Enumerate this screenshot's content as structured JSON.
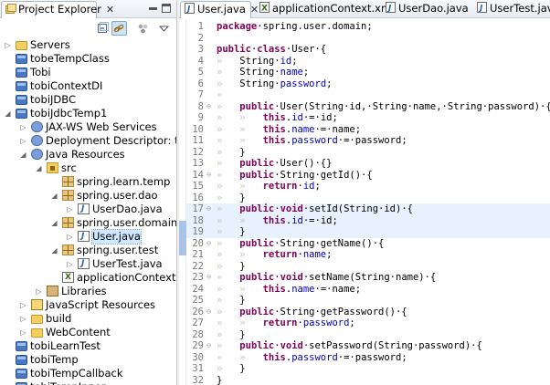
{
  "explorer": {
    "tab_title": "Project Explorer",
    "tree": [
      {
        "label": "Servers",
        "indent": 0,
        "icon": "folder",
        "twisty": "▷"
      },
      {
        "label": "tobeTempClass",
        "indent": 0,
        "icon": "project",
        "twisty": ""
      },
      {
        "label": "Tobi",
        "indent": 0,
        "icon": "project",
        "twisty": ""
      },
      {
        "label": "tobiContextDI",
        "indent": 0,
        "icon": "project",
        "twisty": ""
      },
      {
        "label": "tobiJDBC",
        "indent": 0,
        "icon": "project",
        "twisty": ""
      },
      {
        "label": "tobiJdbcTemp1",
        "indent": 0,
        "icon": "project",
        "twisty": "◢"
      },
      {
        "label": "JAX-WS Web Services",
        "indent": 1,
        "icon": "jaxws",
        "twisty": "▷"
      },
      {
        "label": "Deployment Descriptor: tobiJdb",
        "indent": 1,
        "icon": "dd",
        "twisty": "▷"
      },
      {
        "label": "Java Resources",
        "indent": 1,
        "icon": "jres",
        "twisty": "◢"
      },
      {
        "label": "src",
        "indent": 2,
        "icon": "src",
        "twisty": "◢"
      },
      {
        "label": "spring.learn.temp",
        "indent": 3,
        "icon": "pkg",
        "twisty": ""
      },
      {
        "label": "spring.user.dao",
        "indent": 3,
        "icon": "pkg",
        "twisty": "◢"
      },
      {
        "label": "UserDao.java",
        "indent": 4,
        "icon": "java",
        "twisty": "▷"
      },
      {
        "label": "spring.user.domain",
        "indent": 3,
        "icon": "pkg",
        "twisty": "◢"
      },
      {
        "label": "User.java",
        "indent": 4,
        "icon": "java",
        "twisty": "▷",
        "selected": true
      },
      {
        "label": "spring.user.test",
        "indent": 3,
        "icon": "pkg",
        "twisty": "◢"
      },
      {
        "label": "UserTest.java",
        "indent": 4,
        "icon": "java",
        "twisty": "▷"
      },
      {
        "label": "applicationContext.xml",
        "indent": 3,
        "icon": "xml",
        "twisty": ""
      },
      {
        "label": "Libraries",
        "indent": 2,
        "icon": "lib",
        "twisty": "▷"
      },
      {
        "label": "JavaScript Resources",
        "indent": 1,
        "icon": "js",
        "twisty": "▷"
      },
      {
        "label": "build",
        "indent": 1,
        "icon": "folder",
        "twisty": "▷"
      },
      {
        "label": "WebContent",
        "indent": 1,
        "icon": "folder",
        "twisty": "▷"
      },
      {
        "label": "tobiLearnTest",
        "indent": 0,
        "icon": "project",
        "twisty": ""
      },
      {
        "label": "tobiTemp",
        "indent": 0,
        "icon": "project",
        "twisty": ""
      },
      {
        "label": "tobiTempCallback",
        "indent": 0,
        "icon": "project",
        "twisty": ""
      },
      {
        "label": "tobiTempInner",
        "indent": 0,
        "icon": "project",
        "twisty": ""
      }
    ]
  },
  "editor": {
    "tabs": [
      {
        "label": "User.java",
        "icon": "java-file-icon",
        "active": true
      },
      {
        "label": "applicationContext.xml",
        "icon": "xml-file-icon",
        "active": false
      },
      {
        "label": "UserDao.java",
        "icon": "java-file-icon",
        "active": false
      },
      {
        "label": "UserTest.java",
        "icon": "java-file-icon",
        "active": false
      }
    ],
    "lines": [
      {
        "n": "1",
        "fold": "",
        "hl": false,
        "segs": [
          [
            "kw",
            "package"
          ],
          [
            "",
            "·spring.user.domain;"
          ]
        ]
      },
      {
        "n": "2",
        "fold": "",
        "hl": false,
        "segs": []
      },
      {
        "n": "3",
        "fold": "",
        "hl": false,
        "segs": [
          [
            "kw",
            "public"
          ],
          [
            "",
            "·"
          ],
          [
            "kw",
            "class"
          ],
          [
            "",
            "·User·{"
          ]
        ]
      },
      {
        "n": "4",
        "fold": "",
        "hl": false,
        "segs": [
          [
            "dot",
            "»   "
          ],
          [
            "",
            "String·"
          ],
          [
            "fld",
            "id"
          ],
          [
            "",
            ";"
          ]
        ]
      },
      {
        "n": "5",
        "fold": "",
        "hl": false,
        "segs": [
          [
            "dot",
            "»   "
          ],
          [
            "",
            "String·"
          ],
          [
            "fld",
            "name"
          ],
          [
            "",
            ";"
          ]
        ]
      },
      {
        "n": "6",
        "fold": "",
        "hl": false,
        "segs": [
          [
            "dot",
            "»   "
          ],
          [
            "",
            "String·"
          ],
          [
            "fld",
            "password"
          ],
          [
            "",
            ";"
          ]
        ]
      },
      {
        "n": "7",
        "fold": "",
        "hl": false,
        "segs": [
          [
            "dot",
            "»"
          ]
        ]
      },
      {
        "n": "8",
        "fold": "⊖",
        "hl": false,
        "segs": [
          [
            "dot",
            "»   "
          ],
          [
            "kw",
            "public"
          ],
          [
            "",
            "·User(String·id,·String·name,·String·password)·{"
          ]
        ]
      },
      {
        "n": "9",
        "fold": "",
        "hl": false,
        "segs": [
          [
            "dot",
            "»   »   "
          ],
          [
            "kw",
            "this"
          ],
          [
            "",
            "."
          ],
          [
            "fld",
            "id"
          ],
          [
            "",
            "·=·id;"
          ]
        ]
      },
      {
        "n": "10",
        "fold": "",
        "hl": false,
        "segs": [
          [
            "dot",
            "»   »   "
          ],
          [
            "kw",
            "this"
          ],
          [
            "",
            "."
          ],
          [
            "fld",
            "name"
          ],
          [
            "",
            "·=·name;"
          ]
        ]
      },
      {
        "n": "11",
        "fold": "",
        "hl": false,
        "segs": [
          [
            "dot",
            "»   »   "
          ],
          [
            "kw",
            "this"
          ],
          [
            "",
            "."
          ],
          [
            "fld",
            "password"
          ],
          [
            "",
            "·=·password;"
          ]
        ]
      },
      {
        "n": "12",
        "fold": "",
        "hl": false,
        "segs": [
          [
            "dot",
            "»   "
          ],
          [
            "",
            "}"
          ]
        ]
      },
      {
        "n": "13",
        "fold": "",
        "hl": false,
        "segs": [
          [
            "dot",
            "»   "
          ],
          [
            "kw",
            "public"
          ],
          [
            "",
            "·User()·{}"
          ]
        ]
      },
      {
        "n": "14",
        "fold": "⊖",
        "hl": false,
        "segs": [
          [
            "dot",
            "»   "
          ],
          [
            "kw",
            "public"
          ],
          [
            "",
            "·String·getId()·{"
          ]
        ]
      },
      {
        "n": "15",
        "fold": "",
        "hl": false,
        "segs": [
          [
            "dot",
            "»   »   "
          ],
          [
            "kw",
            "return"
          ],
          [
            "",
            "·"
          ],
          [
            "fld",
            "id"
          ],
          [
            "",
            ";"
          ]
        ]
      },
      {
        "n": "16",
        "fold": "",
        "hl": false,
        "segs": [
          [
            "dot",
            "»   "
          ],
          [
            "",
            "}"
          ]
        ]
      },
      {
        "n": "17",
        "fold": "⊖",
        "hl": true,
        "segs": [
          [
            "dot",
            "»   "
          ],
          [
            "kw",
            "public"
          ],
          [
            "",
            "·"
          ],
          [
            "kw",
            "void"
          ],
          [
            "",
            "·setId(String·id)·{"
          ]
        ]
      },
      {
        "n": "18",
        "fold": "",
        "hl": true,
        "segs": [
          [
            "dot",
            "»   »   "
          ],
          [
            "kw",
            "this"
          ],
          [
            "",
            "."
          ],
          [
            "fld",
            "id"
          ],
          [
            "",
            "·=·id;"
          ]
        ]
      },
      {
        "n": "19",
        "fold": "",
        "hl": true,
        "segs": [
          [
            "dot",
            "»   "
          ],
          [
            "",
            "}"
          ]
        ]
      },
      {
        "n": "20",
        "fold": "⊖",
        "hl": false,
        "segs": [
          [
            "dot",
            "»   "
          ],
          [
            "kw",
            "public"
          ],
          [
            "",
            "·String·getName()·{"
          ]
        ]
      },
      {
        "n": "21",
        "fold": "",
        "hl": false,
        "segs": [
          [
            "dot",
            "»   »   "
          ],
          [
            "kw",
            "return"
          ],
          [
            "",
            "·"
          ],
          [
            "fld",
            "name"
          ],
          [
            "",
            ";"
          ]
        ]
      },
      {
        "n": "22",
        "fold": "",
        "hl": false,
        "segs": [
          [
            "dot",
            "»   "
          ],
          [
            "",
            "}"
          ]
        ]
      },
      {
        "n": "23",
        "fold": "⊖",
        "hl": false,
        "segs": [
          [
            "dot",
            "»   "
          ],
          [
            "kw",
            "public"
          ],
          [
            "",
            "·"
          ],
          [
            "kw",
            "void"
          ],
          [
            "",
            "·setName(String·name)·{"
          ]
        ]
      },
      {
        "n": "24",
        "fold": "",
        "hl": false,
        "segs": [
          [
            "dot",
            "»   »   "
          ],
          [
            "kw",
            "this"
          ],
          [
            "",
            "."
          ],
          [
            "fld",
            "name"
          ],
          [
            "",
            "·=·name;"
          ]
        ]
      },
      {
        "n": "25",
        "fold": "",
        "hl": false,
        "segs": [
          [
            "dot",
            "»   "
          ],
          [
            "",
            "}"
          ]
        ]
      },
      {
        "n": "26",
        "fold": "⊖",
        "hl": false,
        "segs": [
          [
            "dot",
            "»   "
          ],
          [
            "kw",
            "public"
          ],
          [
            "",
            "·String·getPassword()·{"
          ]
        ]
      },
      {
        "n": "27",
        "fold": "",
        "hl": false,
        "segs": [
          [
            "dot",
            "»   »   "
          ],
          [
            "kw",
            "return"
          ],
          [
            "",
            "·"
          ],
          [
            "fld",
            "password"
          ],
          [
            "",
            ";"
          ]
        ]
      },
      {
        "n": "28",
        "fold": "",
        "hl": false,
        "segs": [
          [
            "dot",
            "»   "
          ],
          [
            "",
            "}"
          ]
        ]
      },
      {
        "n": "29",
        "fold": "⊖",
        "hl": false,
        "segs": [
          [
            "dot",
            "»   "
          ],
          [
            "kw",
            "public"
          ],
          [
            "",
            "·"
          ],
          [
            "kw",
            "void"
          ],
          [
            "",
            "·setPassword(String·password)·{"
          ]
        ]
      },
      {
        "n": "30",
        "fold": "",
        "hl": false,
        "segs": [
          [
            "dot",
            "»   »   "
          ],
          [
            "kw",
            "this"
          ],
          [
            "",
            "."
          ],
          [
            "fld",
            "password"
          ],
          [
            "",
            "·=·password;"
          ]
        ]
      },
      {
        "n": "31",
        "fold": "",
        "hl": false,
        "segs": [
          [
            "dot",
            "»   "
          ],
          [
            "",
            "}"
          ]
        ]
      },
      {
        "n": "32",
        "fold": "",
        "hl": false,
        "segs": [
          [
            "",
            "}"
          ]
        ]
      }
    ]
  },
  "colors": {
    "keyword": "#7f0055",
    "field": "#0000c0",
    "whitespace_marker": "#c7c7c7",
    "line_number": "#787878",
    "selection": "#cde8ff"
  }
}
